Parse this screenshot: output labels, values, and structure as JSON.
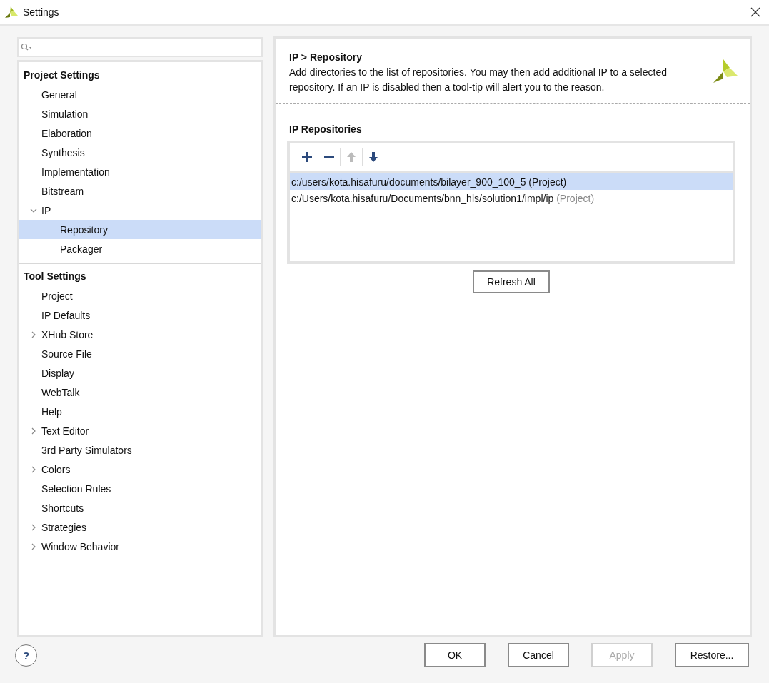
{
  "window": {
    "title": "Settings"
  },
  "sidebar": {
    "sections": [
      {
        "title": "Project Settings",
        "items": [
          {
            "label": "General",
            "selected": false
          },
          {
            "label": "Simulation",
            "selected": false
          },
          {
            "label": "Elaboration",
            "selected": false
          },
          {
            "label": "Synthesis",
            "selected": false
          },
          {
            "label": "Implementation",
            "selected": false
          },
          {
            "label": "Bitstream",
            "selected": false
          },
          {
            "label": "IP",
            "selected": false,
            "expanded": true,
            "children": [
              {
                "label": "Repository",
                "selected": true
              },
              {
                "label": "Packager",
                "selected": false
              }
            ]
          }
        ]
      },
      {
        "title": "Tool Settings",
        "items": [
          {
            "label": "Project",
            "selected": false
          },
          {
            "label": "IP Defaults",
            "selected": false
          },
          {
            "label": "XHub Store",
            "selected": false,
            "expanded": false
          },
          {
            "label": "Source File",
            "selected": false
          },
          {
            "label": "Display",
            "selected": false
          },
          {
            "label": "WebTalk",
            "selected": false
          },
          {
            "label": "Help",
            "selected": false
          },
          {
            "label": "Text Editor",
            "selected": false,
            "expanded": false
          },
          {
            "label": "3rd Party Simulators",
            "selected": false
          },
          {
            "label": "Colors",
            "selected": false,
            "expanded": false
          },
          {
            "label": "Selection Rules",
            "selected": false
          },
          {
            "label": "Shortcuts",
            "selected": false
          },
          {
            "label": "Strategies",
            "selected": false,
            "expanded": false
          },
          {
            "label": "Window Behavior",
            "selected": false,
            "expanded": false
          }
        ]
      }
    ]
  },
  "page": {
    "title": "IP > Repository",
    "description": "Add directories to the list of repositories. You may then add additional IP to a selected repository. If an IP is disabled then a tool-tip will alert you to the reason.",
    "section_title": "IP Repositories",
    "toolbar": [
      {
        "kind": "add",
        "disabled": false
      },
      {
        "kind": "remove",
        "disabled": false
      },
      {
        "kind": "up",
        "disabled": true
      },
      {
        "kind": "down",
        "disabled": false
      }
    ],
    "repositories": [
      {
        "path": "c:/users/kota.hisafuru/documents/bilayer_900_100_5",
        "tag": "(Project)",
        "selected": true
      },
      {
        "path": "c:/Users/kota.hisafuru/Documents/bnn_hls/solution1/impl/ip",
        "tag": "(Project)",
        "selected": false
      }
    ],
    "refresh_button": "Refresh All"
  },
  "buttons": [
    {
      "label": "OK",
      "disabled": false
    },
    {
      "label": "Cancel",
      "disabled": false
    },
    {
      "label": "Apply",
      "disabled": true
    },
    {
      "label": "Restore...",
      "disabled": false
    }
  ],
  "help_button": "?"
}
